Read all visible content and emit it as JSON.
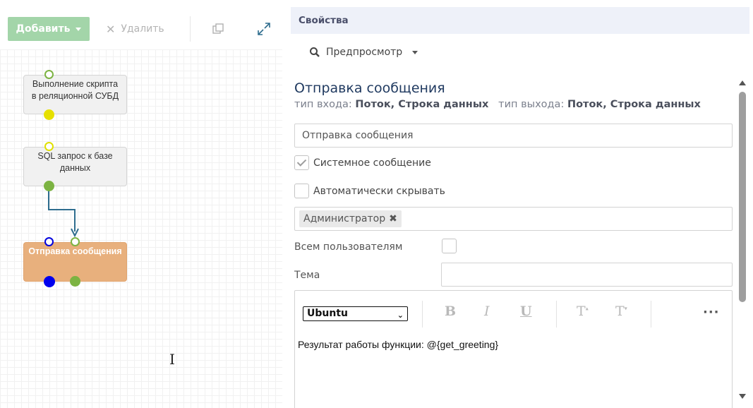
{
  "toolbar": {
    "add_label": "Добавить",
    "delete_label": "Удалить"
  },
  "nodes": [
    {
      "label_line1": "Выполнение скрипта",
      "label_line2": "в реляционной СУБД"
    },
    {
      "label_line1": "SQL запрос к базе",
      "label_line2": "данных"
    },
    {
      "label_line1": "Отправка сообщения",
      "label_line2": ""
    }
  ],
  "properties": {
    "header": "Свойства",
    "preview_label": "Предпросмотр",
    "title": "Отправка сообщения",
    "input_type_label": "тип входа:",
    "input_type_value": "Поток, Строка данных",
    "output_type_label": "тип выхода:",
    "output_type_value": "Поток, Строка данных",
    "name_value": "Отправка сообщения",
    "system_message_label": "Системное сообщение",
    "system_message_checked": true,
    "auto_hide_label": "Автоматически скрывать",
    "auto_hide_checked": false,
    "recipient_tag": "Администратор",
    "all_users_label": "Всем пользователям",
    "subject_label": "Тема",
    "subject_value": "",
    "editor": {
      "font": "Ubuntu",
      "bold_glyph": "B",
      "italic_glyph": "I",
      "underline_glyph": "U",
      "superscript_glyph": "T",
      "subscript_glyph": "T",
      "more_glyph": "···",
      "content": "Результат работы функции: @{get_greeting}"
    }
  },
  "colors": {
    "add_button": "#a3d5a9",
    "active_node": "#e8b07d",
    "port_green": "#7cb342",
    "port_yellow": "#e6e000",
    "port_blue": "#0000ee",
    "connector": "#2e6d8e",
    "header_bg": "#eef1f9"
  }
}
